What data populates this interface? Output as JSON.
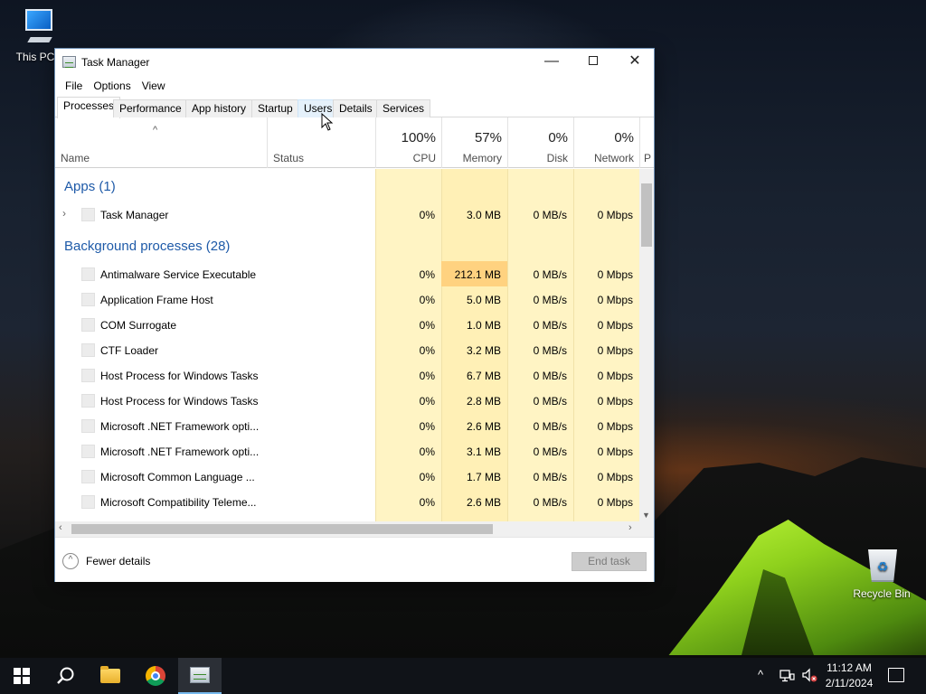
{
  "desktop": {
    "icons": [
      {
        "label": "This PC",
        "icon": "computer-icon"
      },
      {
        "label": "Recycle Bin",
        "icon": "recycle-bin-icon"
      }
    ]
  },
  "window": {
    "title": "Task Manager",
    "controls": {
      "minimize": "—",
      "close": "✕"
    },
    "menu": [
      "File",
      "Options",
      "View"
    ],
    "tabs": [
      "Processes",
      "Performance",
      "App history",
      "Startup",
      "Users",
      "Details",
      "Services"
    ],
    "active_tab": "Processes",
    "hovered_tab": "Users",
    "columns": {
      "name": "Name",
      "status": "Status",
      "cpu": {
        "pct": "100%",
        "label": "CPU"
      },
      "memory": {
        "pct": "57%",
        "label": "Memory"
      },
      "disk": {
        "pct": "0%",
        "label": "Disk"
      },
      "network": {
        "pct": "0%",
        "label": "Network"
      },
      "cut_off": "P"
    },
    "groups": {
      "apps": "Apps (1)",
      "background": "Background processes (28)"
    },
    "app_rows": [
      {
        "name": "Task Manager",
        "cpu": "0%",
        "memory": "3.0 MB",
        "disk": "0 MB/s",
        "network": "0 Mbps"
      }
    ],
    "background_rows": [
      {
        "name": "Antimalware Service Executable",
        "cpu": "0%",
        "memory": "212.1 MB",
        "disk": "0 MB/s",
        "network": "0 Mbps"
      },
      {
        "name": "Application Frame Host",
        "cpu": "0%",
        "memory": "5.0 MB",
        "disk": "0 MB/s",
        "network": "0 Mbps"
      },
      {
        "name": "COM Surrogate",
        "cpu": "0%",
        "memory": "1.0 MB",
        "disk": "0 MB/s",
        "network": "0 Mbps"
      },
      {
        "name": "CTF Loader",
        "cpu": "0%",
        "memory": "3.2 MB",
        "disk": "0 MB/s",
        "network": "0 Mbps"
      },
      {
        "name": "Host Process for Windows Tasks",
        "cpu": "0%",
        "memory": "6.7 MB",
        "disk": "0 MB/s",
        "network": "0 Mbps"
      },
      {
        "name": "Host Process for Windows Tasks",
        "cpu": "0%",
        "memory": "2.8 MB",
        "disk": "0 MB/s",
        "network": "0 Mbps"
      },
      {
        "name": "Microsoft .NET Framework opti...",
        "cpu": "0%",
        "memory": "2.6 MB",
        "disk": "0 MB/s",
        "network": "0 Mbps"
      },
      {
        "name": "Microsoft .NET Framework opti...",
        "cpu": "0%",
        "memory": "3.1 MB",
        "disk": "0 MB/s",
        "network": "0 Mbps"
      },
      {
        "name": "Microsoft Common Language ...",
        "cpu": "0%",
        "memory": "1.7 MB",
        "disk": "0 MB/s",
        "network": "0 Mbps"
      },
      {
        "name": "Microsoft Compatibility Teleme...",
        "cpu": "0%",
        "memory": "2.6 MB",
        "disk": "0 MB/s",
        "network": "0 Mbps"
      }
    ],
    "footer": {
      "fewer_details": "Fewer details",
      "end_task": "End task"
    }
  },
  "taskbar": {
    "apps": [
      "start-icon",
      "search-icon",
      "file-explorer-icon",
      "chrome-icon",
      "task-manager-icon"
    ],
    "clock": {
      "time": "11:12 AM",
      "date": "2/11/2024"
    }
  },
  "colors": {
    "group_title": "#1e5aa8",
    "heat_light": "#fff4c4",
    "heat_high": "#ffd280",
    "taskbar": "#101318"
  }
}
